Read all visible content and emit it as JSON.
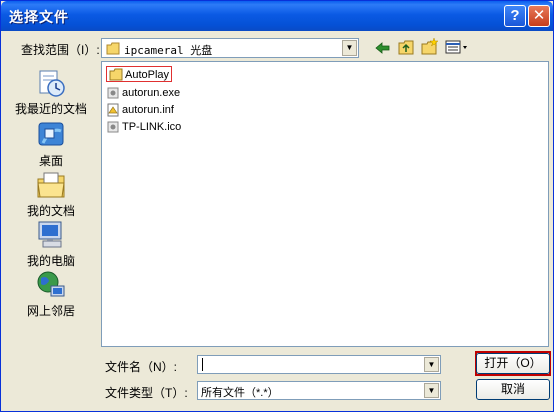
{
  "window": {
    "title": "选择文件",
    "help_label": "?",
    "close_label": "✕"
  },
  "lookin": {
    "label": "查找范围（I）:",
    "value": "ipcameral 光盘"
  },
  "toolbar": {
    "back_icon": "back-arrow-icon",
    "up_icon": "up-folder-icon",
    "newfolder_icon": "new-folder-icon",
    "views_icon": "views-menu-icon"
  },
  "sidebar": {
    "items": [
      {
        "label": "我最近的文档",
        "icon": "recent-documents-icon"
      },
      {
        "label": "桌面",
        "icon": "desktop-icon"
      },
      {
        "label": "我的文档",
        "icon": "my-documents-icon"
      },
      {
        "label": "我的电脑",
        "icon": "my-computer-icon"
      },
      {
        "label": "网上邻居",
        "icon": "network-places-icon"
      }
    ]
  },
  "files": [
    {
      "name": "AutoPlay",
      "icon": "folder-icon"
    },
    {
      "name": "autorun.exe",
      "icon": "exe-file-icon"
    },
    {
      "name": "autorun.inf",
      "icon": "inf-file-icon"
    },
    {
      "name": "TP-LINK.ico",
      "icon": "ico-file-icon"
    }
  ],
  "filename": {
    "label": "文件名（N）:",
    "value": ""
  },
  "filetype": {
    "label": "文件类型（T）:",
    "value": "所有文件（*.*）"
  },
  "buttons": {
    "open": "打开（O）",
    "cancel": "取消"
  },
  "colors": {
    "titlebar": "#0A5FEF",
    "highlight": "#E03030"
  }
}
